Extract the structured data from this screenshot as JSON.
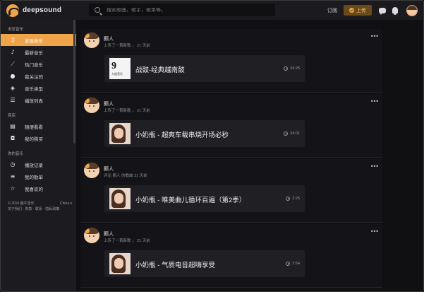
{
  "header": {
    "logo_text": "deepsound",
    "search_placeholder": "搜索歌曲，歌手，歌单等。",
    "subscribe_label": "订阅",
    "upload_label": "上传"
  },
  "sidebar": {
    "browse_title": "浏览音乐",
    "browse_items": [
      {
        "label": "发现音乐",
        "icon": "music-note-icon",
        "glyph": "♫"
      },
      {
        "label": "最新音乐",
        "icon": "single-note-icon",
        "glyph": "♪"
      },
      {
        "label": "热门音乐",
        "icon": "trend-chart-icon",
        "glyph": "⟋"
      },
      {
        "label": "我关注的",
        "icon": "drop-icon",
        "glyph": "●"
      },
      {
        "label": "音乐类型",
        "icon": "layers-icon",
        "glyph": "◈"
      },
      {
        "label": "播放列表",
        "icon": "playlist-icon",
        "glyph": "☰"
      }
    ],
    "store_title": "商店",
    "store_items": [
      {
        "label": "随便看看",
        "icon": "store-icon",
        "glyph": "▤"
      },
      {
        "label": "我的购买",
        "icon": "bag-icon",
        "glyph": "◘"
      }
    ],
    "mine_title": "你的音乐",
    "mine_items": [
      {
        "label": "播放记录",
        "icon": "history-icon",
        "glyph": "◷"
      },
      {
        "label": "我的歌单",
        "icon": "my-playlist-icon",
        "glyph": "≡"
      },
      {
        "label": "我喜欢的",
        "icon": "star-icon",
        "glyph": "☆"
      }
    ],
    "footer_copyright": "© 2019 趣牛音乐",
    "footer_region": "China ▾",
    "footer_links": "关于我们 · 条款 · 联系 · 隐私政策"
  },
  "feed": [
    {
      "name": "颢人",
      "meta": "上传了一首新歌 ， 21 天前",
      "title": "战鼓-经典越南鼓",
      "duration": "34:25",
      "cover": "white",
      "cover_text": "9",
      "cover_sub": "九极音乐"
    },
    {
      "name": "颢人",
      "meta": "上传了一首新歌 ， 21 天前",
      "title": "小奶瓶 - 超爽车载串烧开场必秒",
      "duration": "34:01",
      "cover": "photo"
    },
    {
      "name": "颢人",
      "meta": "评论 颢人 的歌曲 21 天前",
      "title": "小奶瓶 - 唯美曲儿循环百遍（第2季）",
      "duration": "2:25",
      "cover": "photo"
    },
    {
      "name": "颢人",
      "meta": "上传了一首新歌 ， 21 天前",
      "title": "小奶瓶 - 气质电音超嗨享受",
      "duration": "2:54",
      "cover": "photo"
    }
  ]
}
